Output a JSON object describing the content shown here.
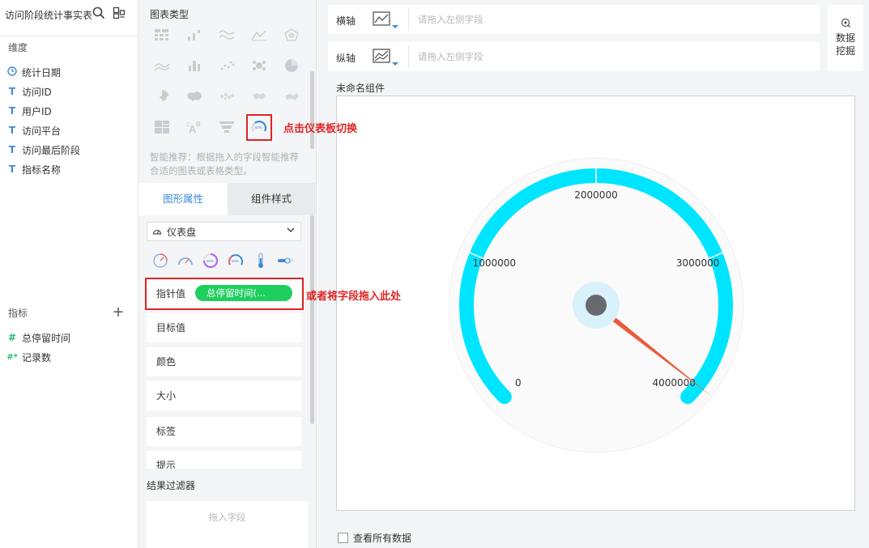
{
  "left": {
    "dataset_title": "访问阶段统计事实表",
    "icons": [
      "search-icon",
      "layout-icon"
    ],
    "dimensions_label": "维度",
    "dimensions": [
      {
        "type": "date",
        "icon": "clock-icon",
        "label": "统计日期"
      },
      {
        "type": "text",
        "icon": "text-icon",
        "label": "访问ID"
      },
      {
        "type": "text",
        "icon": "text-icon",
        "label": "用户ID"
      },
      {
        "type": "text",
        "icon": "text-icon",
        "label": "访问平台"
      },
      {
        "type": "text",
        "icon": "text-icon",
        "label": "访问最后阶段"
      },
      {
        "type": "text",
        "icon": "text-icon",
        "label": "指标名称"
      }
    ],
    "measures_label": "指标",
    "add_icon": "plus-icon",
    "measures": [
      {
        "icon": "hash-icon",
        "prefix": "#",
        "label": "总停留时间"
      },
      {
        "icon": "hash-star-icon",
        "prefix": "#*",
        "label": "记录数"
      }
    ]
  },
  "config": {
    "chart_type_title": "图表类型",
    "hint": "智能推荐：根据拖入的字段智能推荐合适的图表或表格类型。",
    "tabs": {
      "shape": "图形属性",
      "style": "组件样式"
    },
    "selected_type": "仪表盘",
    "pointer_label": "指针值",
    "pointer_field": "总停留时间(...",
    "props": [
      "目标值",
      "颜色",
      "大小",
      "标签",
      "提示"
    ],
    "result_filter_title": "结果过滤器",
    "drop_placeholder": "拖入字段"
  },
  "axes": {
    "x_label": "横轴",
    "y_label": "纵轴",
    "placeholder": "请拖入左侧字段"
  },
  "mining": {
    "label": "数据挖掘"
  },
  "component": {
    "name": "未命名组件",
    "view_all": "查看所有数据"
  },
  "annotations": {
    "switch_note": "点击仪表板切换",
    "drag_note": "或者将字段拖入此处"
  },
  "colors": {
    "accent": "#3d8bd4",
    "gauge": "#00e5ff",
    "pill": "#1ecf5e",
    "needle": "#ec5a3c",
    "annotation": "#e02424"
  },
  "gauge": {
    "min": 0,
    "max": 4000000,
    "ticks": [
      0,
      1000000,
      2000000,
      3000000,
      4000000
    ],
    "tick_labels": [
      "0",
      "1000000",
      "2000000",
      "3000000",
      "4000000"
    ],
    "value": 3900000
  }
}
